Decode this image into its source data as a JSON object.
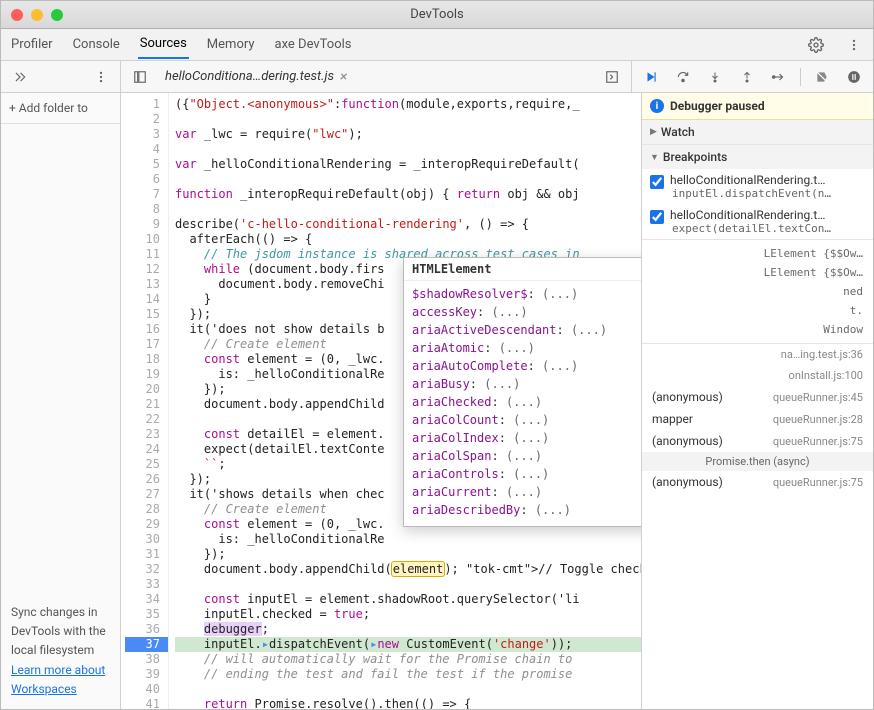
{
  "window": {
    "title": "DevTools"
  },
  "tabs": [
    "Profiler",
    "Console",
    "Sources",
    "Memory",
    "axe DevTools"
  ],
  "active_tab": "Sources",
  "file_tab": {
    "name": "helloConditiona…dering.test.js"
  },
  "nav": {
    "add_folder": "+ Add folder to",
    "sync_text": "Sync changes in DevTools with the local filesystem",
    "learn_more": "Learn more about",
    "workspaces": "Workspaces"
  },
  "code": {
    "lines": [
      "({\"Object.<anonymous>\":function(module,exports,require,_",
      "",
      "var _lwc = require(\"lwc\");",
      "",
      "var _helloConditionalRendering = _interopRequireDefault(",
      "",
      "function _interopRequireDefault(obj) { return obj && obj",
      "",
      "describe('c-hello-conditional-rendering', () => {",
      "  afterEach(() => {",
      "    // The jsdom instance is shared across test cases in",
      "    while (document.body.firs",
      "      document.body.removeChi",
      "    }",
      "  });",
      "  it('does not show details b",
      "    // Create element",
      "    const element = (0, _lwc.",
      "      is: _helloConditionalRe",
      "    });",
      "    document.body.appendChild",
      "",
      "    const detailEl = element.",
      "    expect(detailEl.textConte",
      "    ``;",
      "  });",
      "  it('shows details when chec",
      "    // Create element",
      "    const element = (0, _lwc.",
      "      is: _helloConditionalRe",
      "    });",
      "    document.body.appendChild(element); // Toggle checkb",
      "",
      "    const inputEl = element.shadowRoot.querySelector('li",
      "    inputEl.checked = true;",
      "    debugger;",
      "    inputEl.dispatchEvent(new CustomEvent('change'));",
      "    // will automatically wait for the Promise chain to ",
      "    // ending the test and fail the test if the promise ",
      "",
      "    return Promise.resolve().then(() => {"
    ],
    "first_line_no": 1,
    "highlighted_line": 37
  },
  "tooltip": {
    "title": "HTMLElement",
    "props": [
      "$shadowResolver$",
      "accessKey",
      "ariaActiveDescendant",
      "ariaAtomic",
      "ariaAutoComplete",
      "ariaBusy",
      "ariaChecked",
      "ariaColCount",
      "ariaColIndex",
      "ariaColSpan",
      "ariaControls",
      "ariaCurrent",
      "ariaDescribedBy"
    ],
    "value_placeholder": "(...)"
  },
  "debugger": {
    "paused_msg": "Debugger paused",
    "sections": {
      "watch": "Watch",
      "breakpoints": "Breakpoints"
    },
    "breakpoints": [
      {
        "file": "helloConditionalRendering.t…",
        "code": "inputEl.dispatchEvent(n…",
        "checked": true
      },
      {
        "file": "helloConditionalRendering.t…",
        "code": "expect(detailEl.textCon…",
        "checked": true
      }
    ],
    "scope": [
      {
        "left": "",
        "right": "LElement {$$Ow…"
      },
      {
        "left": "",
        "right": "LElement {$$Ow…"
      },
      {
        "left": "",
        "right": "ned"
      },
      {
        "left": "",
        "right": "t."
      },
      {
        "left": "",
        "right": "Window"
      }
    ],
    "callstack": [
      {
        "fn": "",
        "loc": "na…ing.test.js:36"
      },
      {
        "fn": "",
        "loc": "onInstall.js:100"
      },
      {
        "fn": "(anonymous)",
        "loc": "queueRunner.js:45"
      },
      {
        "fn": "mapper",
        "loc": "queueRunner.js:28"
      },
      {
        "fn": "(anonymous)",
        "loc": "queueRunner.js:75"
      },
      {
        "async": "Promise.then (async)"
      },
      {
        "fn": "(anonymous)",
        "loc": "queueRunner.js:75"
      }
    ]
  }
}
